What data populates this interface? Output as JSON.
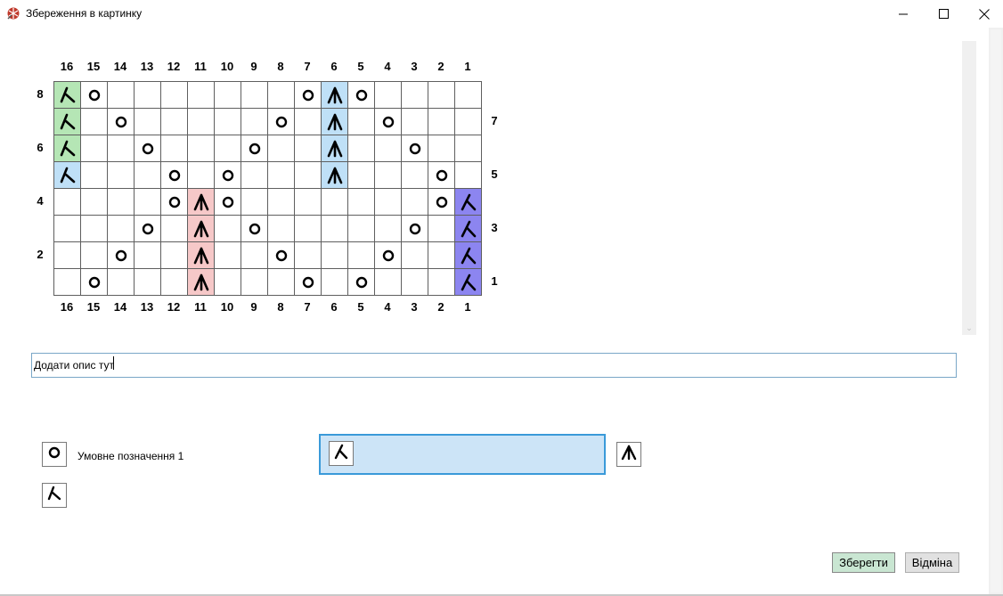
{
  "window": {
    "title": "Збереження в картинку",
    "minimize_icon": "minimize-icon",
    "maximize_icon": "maximize-icon",
    "close_icon": "close-icon"
  },
  "chart": {
    "column_numbers": [
      "16",
      "15",
      "14",
      "13",
      "12",
      "11",
      "10",
      "9",
      "8",
      "7",
      "6",
      "5",
      "4",
      "3",
      "2",
      "1"
    ],
    "left_row_numbers": [
      "8",
      "",
      "6",
      "",
      "4",
      "",
      "2",
      ""
    ],
    "right_row_numbers": [
      "",
      "7",
      "",
      "5",
      "",
      "3",
      "",
      "1"
    ],
    "colors": {
      "green": "#b5e6b5",
      "blue": "#bfe0f7",
      "red": "#f6c8c8",
      "purple": "#8c85f0"
    },
    "rows": [
      [
        "lean-green",
        "yo",
        "",
        "",
        "",
        "",
        "",
        "",
        "",
        "yo",
        "dbl-blue",
        "yo",
        "",
        "",
        "",
        ""
      ],
      [
        "lean-green",
        "",
        "yo",
        "",
        "",
        "",
        "",
        "",
        "yo",
        "",
        "dbl-blue",
        "",
        "yo",
        "",
        "",
        ""
      ],
      [
        "lean-green",
        "",
        "",
        "yo",
        "",
        "",
        "",
        "yo",
        "",
        "",
        "dbl-blue",
        "",
        "",
        "yo",
        "",
        ""
      ],
      [
        "lean-blue",
        "",
        "",
        "",
        "yo",
        "",
        "yo",
        "",
        "",
        "",
        "dbl-blue",
        "",
        "",
        "",
        "yo",
        ""
      ],
      [
        "",
        "",
        "",
        "",
        "yo",
        "dbl-red",
        "yo",
        "",
        "",
        "",
        "",
        "",
        "",
        "",
        "yo",
        "lam-purple"
      ],
      [
        "",
        "",
        "",
        "yo",
        "",
        "dbl-red",
        "",
        "yo",
        "",
        "",
        "",
        "",
        "",
        "yo",
        "",
        "lam-purple"
      ],
      [
        "",
        "",
        "yo",
        "",
        "",
        "dbl-red",
        "",
        "",
        "yo",
        "",
        "",
        "",
        "yo",
        "",
        "",
        "lam-purple"
      ],
      [
        "",
        "yo",
        "",
        "",
        "",
        "dbl-red",
        "",
        "",
        "",
        "yo",
        "",
        "yo",
        "",
        "",
        "",
        "lam-purple"
      ]
    ]
  },
  "description": {
    "value": "Додати опис тут",
    "placeholder": ""
  },
  "legend": {
    "items": [
      {
        "symbol": "yarn-over-icon",
        "label": "Умовне позначення 1"
      },
      {
        "symbol": "lambda-icon",
        "label": "",
        "selected": true
      },
      {
        "symbol": "double-decrease-icon",
        "label": ""
      },
      {
        "symbol": "left-lean-icon",
        "label": ""
      }
    ]
  },
  "buttons": {
    "save_label": "Зберегти",
    "cancel_label": "Відміна"
  }
}
